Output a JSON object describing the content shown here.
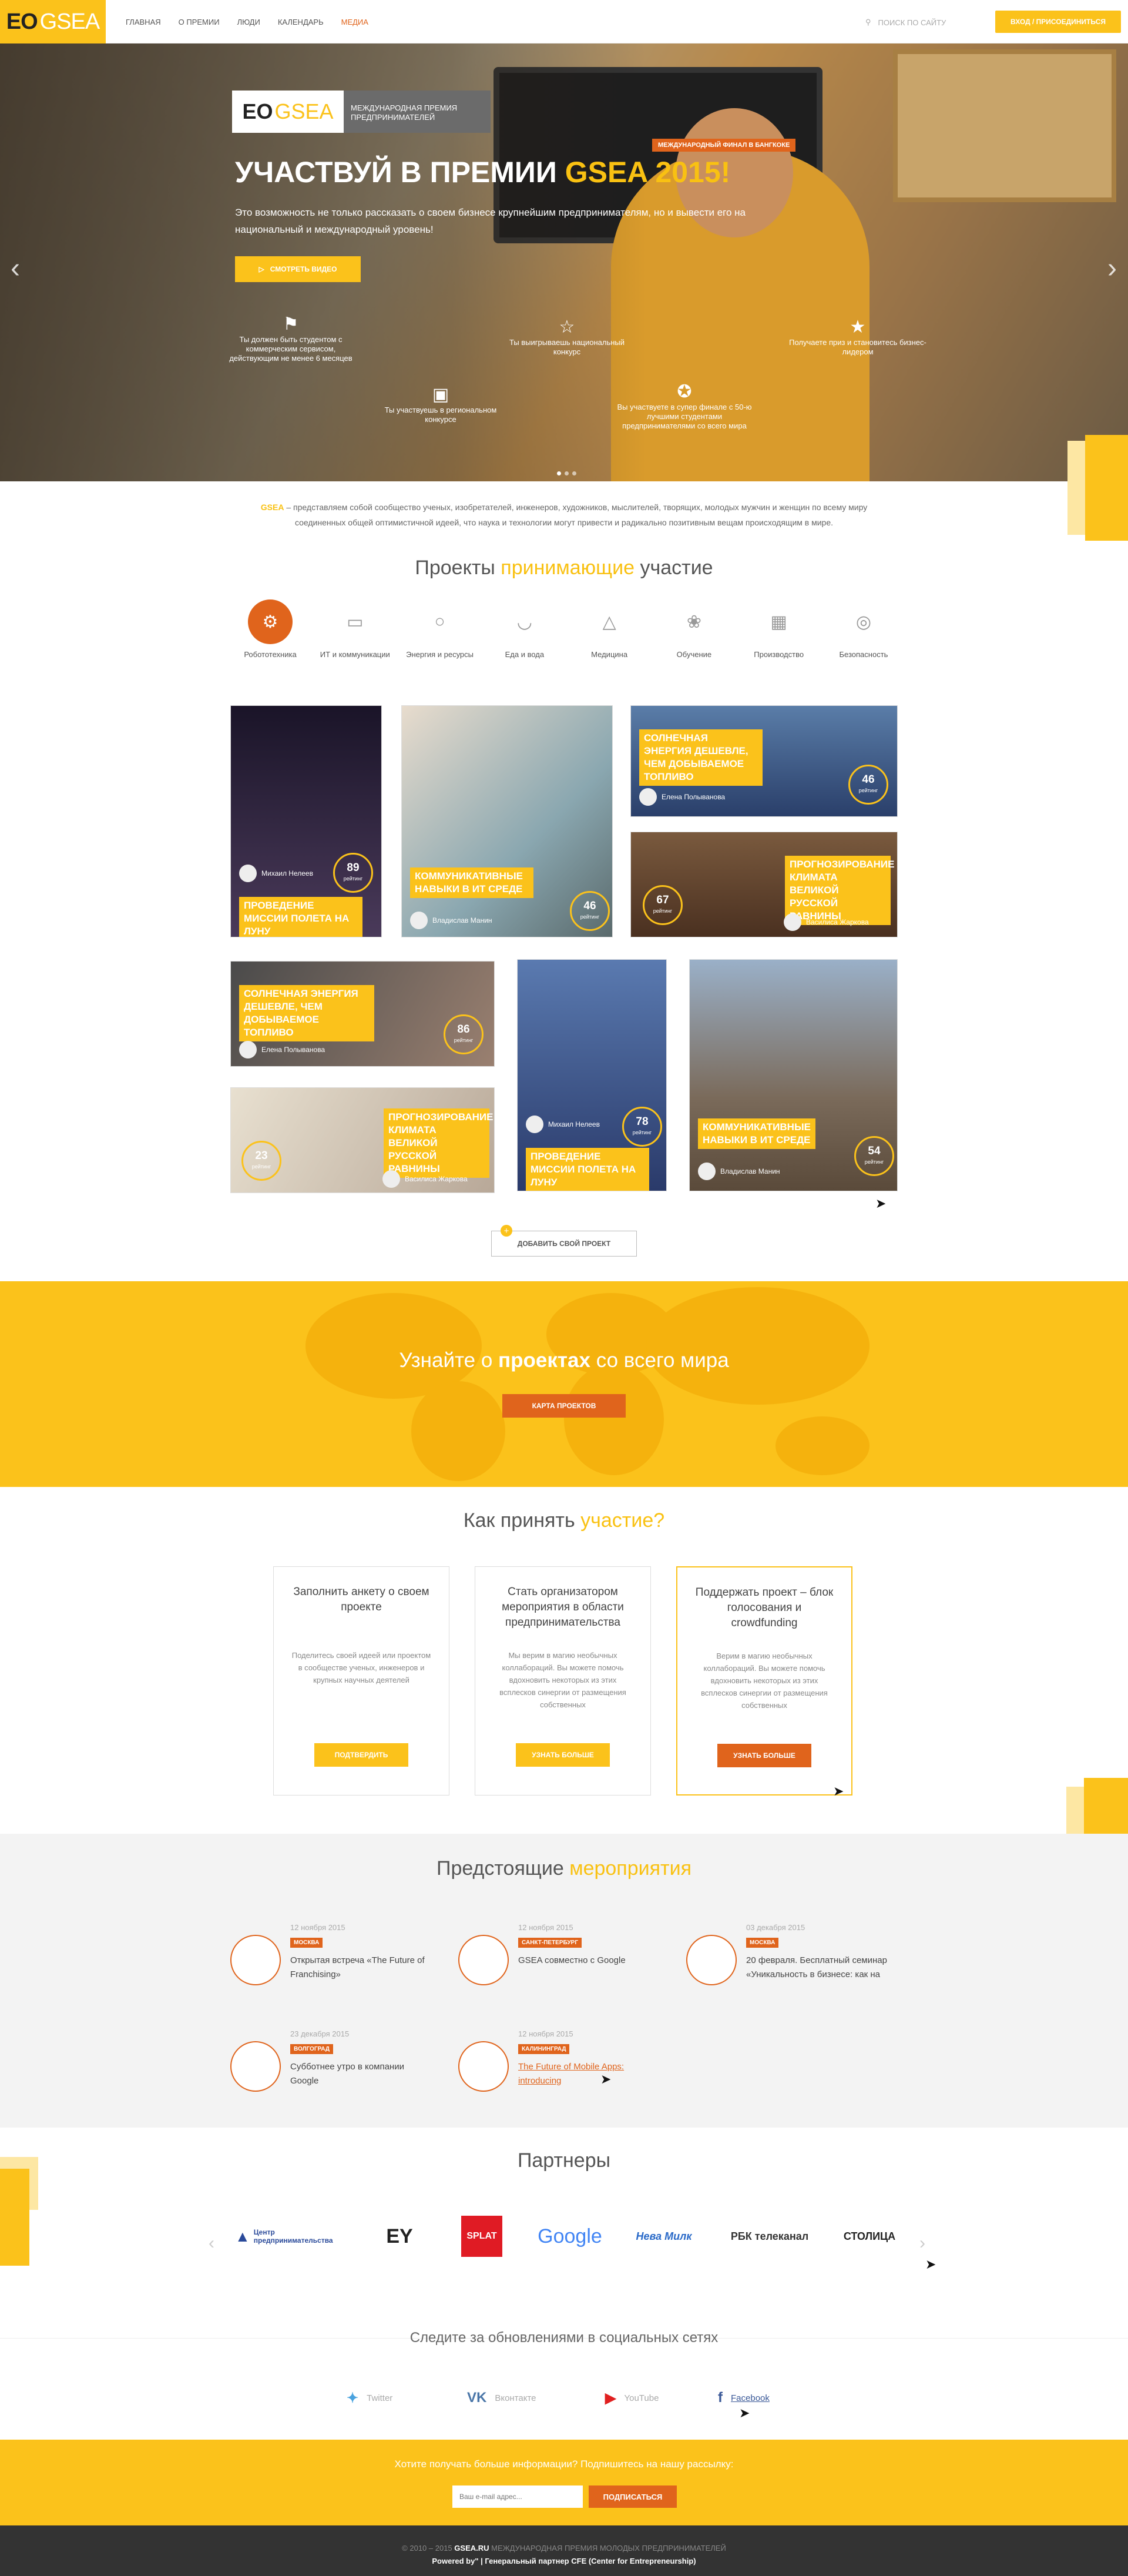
{
  "header": {
    "logo_eo": "EO",
    "logo_gsea": "GSEA",
    "nav": [
      "ГЛАВНАЯ",
      "О ПРЕМИИ",
      "ЛЮДИ",
      "КАЛЕНДАРЬ",
      "МЕДИА"
    ],
    "search_placeholder": "ПОИСК ПО САЙТУ",
    "login": "ВХОД / ПРИСОЕДИНИТЬСЯ"
  },
  "hero": {
    "logo_eo": "EO",
    "logo_gsea": "GSEA",
    "logo_caption": "МЕЖДУНАРОДНАЯ ПРЕМИЯ ПРЕДПРИНИМАТЕЛЕЙ",
    "badge": "МЕЖДУНАРОДНЫЙ ФИНАЛ В БАНГКОКЕ",
    "title_start": "УЧАСТВУЙ В ПРЕМИИ ",
    "title_accent": "GSEA 2015!",
    "text": "Это возможность не только рассказать о своем бизнесе крупнейшим предпринимателям, но и вывести его на национальный и международный уровень!",
    "video_btn": "СМОТРЕТЬ ВИДЕО",
    "steps": [
      "Ты должен быть студентом с коммерческим сервисом, действующим не менее 6 месяцев",
      "Ты участвуешь в региональном конкурсе",
      "Ты выигрываешь национальный конкурс",
      "Вы участвуете в супер финале с 50-ю лучшими студентами предпринимателями со всего мира",
      "Получаете приз и становитесь бизнес-лидером"
    ]
  },
  "about": {
    "brand": "GSEA",
    "text": " – представляем собой сообщество ученых, изобретателей, инженеров, художников, мыслителей, творящих, молодых мужчин и женщин по всему миру соединенных общей оптимистичной идеей, что наука и технологии могут привести и радикально позитивным вещам происходящим в мире."
  },
  "projects": {
    "title_start": "Проекты ",
    "title_accent": "принимающие",
    "title_end": " участие",
    "categories": [
      "Робототехника",
      "ИТ и коммуникации",
      "Энергия и ресурсы",
      "Еда и вода",
      "Медицина",
      "Обучение",
      "Производство",
      "Безопасность"
    ],
    "cards": [
      {
        "tag": "ПРОВЕДЕНИЕ МИССИИ ПОЛЕТА НА ЛУНУ",
        "author": "Михаил Нелеев",
        "rating": "89",
        "rating_label": "рейтинг"
      },
      {
        "tag": "КОММУНИКАТИВНЫЕ НАВЫКИ В ИТ СРЕДЕ",
        "author": "Владислав Манин",
        "rating": "46",
        "rating_label": "рейтинг"
      },
      {
        "tag": "СОЛНЕЧНАЯ ЭНЕРГИЯ ДЕШЕВЛЕ, ЧЕМ ДОБЫВАЕМОЕ ТОПЛИВО",
        "author": "Елена Полыванова",
        "rating": "46",
        "rating_label": "рейтинг"
      },
      {
        "tag": "ПРОГНОЗИРОВАНИЕ КЛИМАТА ВЕЛИКОЙ РУССКОЙ РАВНИНЫ",
        "author": "Василиса Жаркова",
        "rating": "67",
        "rating_label": "рейтинг"
      },
      {
        "tag": "СОЛНЕЧНАЯ ЭНЕРГИЯ ДЕШЕВЛЕ, ЧЕМ ДОБЫВАЕМОЕ ТОПЛИВО",
        "author": "Елена Полыванова",
        "rating": "86",
        "rating_label": "рейтинг"
      },
      {
        "tag": "ПРОВЕДЕНИЕ МИССИИ ПОЛЕТА НА ЛУНУ",
        "author": "Михаил Нелеев",
        "rating": "78",
        "rating_label": "рейтинг"
      },
      {
        "tag": "КОММУНИКАТИВНЫЕ НАВЫКИ В ИТ СРЕДЕ",
        "author": "Владислав Манин",
        "rating": "54",
        "rating_label": "рейтинг"
      },
      {
        "tag": "ПРОГНОЗИРОВАНИЕ КЛИМАТА ВЕЛИКОЙ РУССКОЙ РАВНИНЫ",
        "author": "Василиса Жаркова",
        "rating": "23",
        "rating_label": "рейтинг"
      }
    ],
    "add_btn": "ДОБАВИТЬ СВОЙ ПРОЕКТ"
  },
  "map": {
    "title_start": "Узнайте о ",
    "title_accent": "проектах",
    "title_end": " со всего мира",
    "btn": "КАРТА ПРОЕКТОВ"
  },
  "participate": {
    "title_start": "Как принять ",
    "title_accent": "участие?",
    "boxes": [
      {
        "title": "Заполнить анкету о своем проекте",
        "text": "Поделитесь своей идеей или проектом в сообществе ученых, инженеров и крупных научных деятелей",
        "btn": "ПОДТВЕРДИТЬ"
      },
      {
        "title": "Стать организатором мероприятия в области предпринимательства",
        "text": "Мы верим в магию необычных коллабораций. Вы можете помочь вдохновить некоторых из этих всплесков синергии от размещения собственных",
        "btn": "УЗНАТЬ БОЛЬШЕ"
      },
      {
        "title": "Поддержать проект – блок голосования и crowdfunding",
        "text": "Верим в магию необычных коллабораций. Вы можете помочь вдохновить некоторых из этих всплесков синергии от размещения собственных",
        "btn": "УЗНАТЬ БОЛЬШЕ"
      }
    ]
  },
  "events": {
    "title_start": "Предстоящие ",
    "title_accent": "мероприятия",
    "items": [
      {
        "date": "12 ноября 2015",
        "city": "МОСКВА",
        "title": "Открытая встреча «The Future of Franchising»"
      },
      {
        "date": "12 ноября 2015",
        "city": "САНКТ-ПЕТЕРБУРГ",
        "title": "GSEA совместно с Google"
      },
      {
        "date": "03 декабря 2015",
        "city": "МОСКВА",
        "title": "20 февраля. Бесплатный семинар «Уникальность в бизнесе: как на"
      },
      {
        "date": "23 декабря 2015",
        "city": "ВОЛГОГРАД",
        "title": "Субботнее утро в компании Google"
      },
      {
        "date": "12 ноября 2015",
        "city": "КАЛИНИНГРАД",
        "title": "The Future of Mobile Apps: introducing"
      }
    ]
  },
  "partners": {
    "title": "Партнеры",
    "logos": [
      "Центр предпринимательства",
      "EY",
      "SPLAT",
      "Google",
      "Нева Милк",
      "РБК телеканал",
      "СТОЛИЦА"
    ]
  },
  "social": {
    "title": "Следите за обновлениями в социальных сетях",
    "items": [
      {
        "label": "Twitter",
        "icon": "twitter-icon"
      },
      {
        "label": "Вконтакте",
        "icon": "vk-icon"
      },
      {
        "label": "YouTube",
        "icon": "youtube-icon"
      },
      {
        "label": "Facebook",
        "icon": "facebook-icon"
      }
    ]
  },
  "newsletter": {
    "title": "Хотите получать больше информации? Подпишитесь на нашу рассылку:",
    "placeholder": "Ваш e-mail адрес...",
    "btn": "ПОДПИСАТЬСЯ"
  },
  "footer": {
    "line1_start": "© 2010 – 2015 ",
    "line1_brand": "GSEA.RU",
    "line1_end": " МЕЖДУНАРОДНАЯ ПРЕМИЯ МОЛОДЫХ ПРЕДПРИНИМАТЕЛЕЙ",
    "line2": "Powered by\" | Генеральный партнер CFE (Center for Entrepreneurship)"
  }
}
